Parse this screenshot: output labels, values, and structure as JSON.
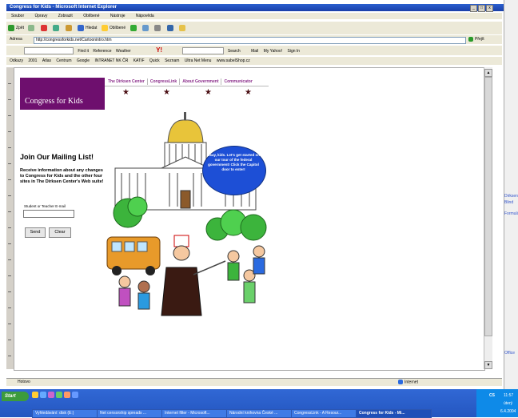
{
  "window": {
    "title": "Congress for Kids - Microsoft Internet Explorer",
    "min": "_",
    "max": "□",
    "close": "x"
  },
  "menu": [
    "Soubor",
    "Úpravy",
    "Zobrazit",
    "Oblíbené",
    "Nástroje",
    "Nápověda"
  ],
  "toolbar": {
    "back": "Zpět",
    "search": "Hledat",
    "favorites": "Oblíbené"
  },
  "address": {
    "label": "Adresa",
    "url": "http://congressforkids.net/Cartoonintro.htm",
    "go": "Přejít"
  },
  "yahoo_bar": {
    "find": "Find it",
    "reference": "Reference",
    "weather": "Weather",
    "search": "Search",
    "mail": "Mail",
    "my_yahoo": "My Yahoo!",
    "sign_in": "Sign In"
  },
  "links": {
    "label": "Odkazy",
    "items": [
      "2001",
      "Atlas",
      "Centrum",
      "Google",
      "INTRANET NK ČR",
      "KATIF",
      "Quick",
      "Seznam",
      "Ultra Net Menu",
      "www.sabelShop.cz"
    ]
  },
  "page": {
    "banner_title": "Congress for Kids",
    "nav": [
      "The Dirksen Center",
      "CongressLink",
      "About Government",
      "Communicator"
    ],
    "mailing_title": "Join Our Mailing List!",
    "mailing_text": "Receive information about any changes to Congress for Kids and the other four sites in The Dirksen Center's Web suite!",
    "email_label": "Student or Teacher E-mail",
    "send": "Send",
    "clear": "Clear",
    "bubble": "Okay, kids. Let's get started on our tour of the federal government! Click the Capitol door to enter!"
  },
  "status": {
    "left": "Hotovo",
    "right": "Internet"
  },
  "taskbar": {
    "start": "Start",
    "buttons": [
      "Vyhledávání: disk (E:)",
      "Net censorship spreads ...",
      "Internet filter - Microsoft...",
      "Národní knihovna České ...",
      "CongressLink - A Resour...",
      "Congress for Kids - Mi..."
    ],
    "time": "11:57",
    "day": "úterý",
    "date": "6.4.2004",
    "lang": "CS"
  },
  "right_panel": {
    "items": [
      "Dirksen",
      "Blind",
      "Formulář",
      "Office"
    ]
  }
}
